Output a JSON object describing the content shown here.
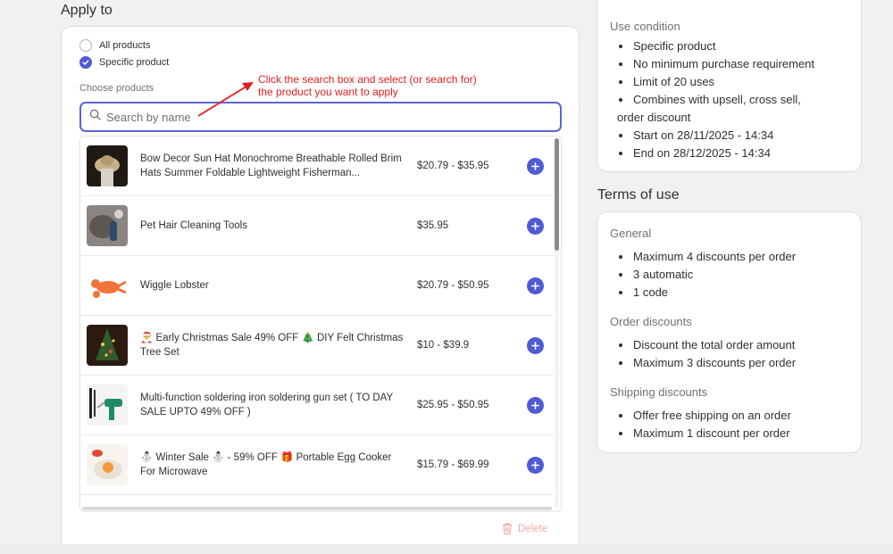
{
  "apply_to": {
    "title": "Apply to",
    "options": [
      {
        "label": "All products",
        "checked": false
      },
      {
        "label": "Specific product",
        "checked": true
      }
    ],
    "choose_label": "Choose products",
    "search_placeholder": "Search by name",
    "search_value": "",
    "products": [
      {
        "name": "Bow Decor Sun Hat Monochrome Breathable Rolled Brim Hats Summer Foldable Lightweight Fisherman...",
        "price": "$20.79 - $35.95"
      },
      {
        "name": "Pet Hair Cleaning Tools",
        "price": "$35.95"
      },
      {
        "name": "Wiggle Lobster",
        "price": "$20.79 - $50.95"
      },
      {
        "name": "🎅 Early Christmas Sale 49% OFF 🎄 DIY Felt Christmas Tree Set",
        "price": "$10 - $39.9"
      },
      {
        "name": "Multi-function soldering iron soldering gun set ( TO DAY SALE UPTO 49% OFF )",
        "price": "$25.95 - $50.95"
      },
      {
        "name": "⛄ Winter Sale ⛄ - 59% OFF 🎁 Portable Egg Cooker For Microwave",
        "price": "$15.79 - $69.99"
      }
    ],
    "delete_label": "Delete"
  },
  "annotation": {
    "line1": "Click the search box and select (or search for)",
    "line2": "the product you want to apply"
  },
  "summary": {
    "label": "Use condition",
    "items": [
      "Specific product",
      "No minimum purchase requirement",
      "Limit of 20 uses",
      "Combines with upsell, cross sell,"
    ],
    "items_cont": "order discount",
    "items_tail": [
      "Start on 28/11/2025 - 14:34",
      "End on 28/12/2025 - 14:34"
    ]
  },
  "terms": {
    "title": "Terms of use",
    "general_label": "General",
    "general": [
      "Maximum 4 discounts per order",
      "3 automatic",
      "1 code"
    ],
    "order_label": "Order discounts",
    "order": [
      "Discount the total order amount",
      "Maximum 3 discounts per order"
    ],
    "shipping_label": "Shipping discounts",
    "shipping": [
      "Offer free shipping on an order",
      "Maximum 1 discount per order"
    ]
  },
  "colors": {
    "accent": "#4f5bd5",
    "annotation": "#e02020",
    "delete": "#f1a8a8"
  }
}
